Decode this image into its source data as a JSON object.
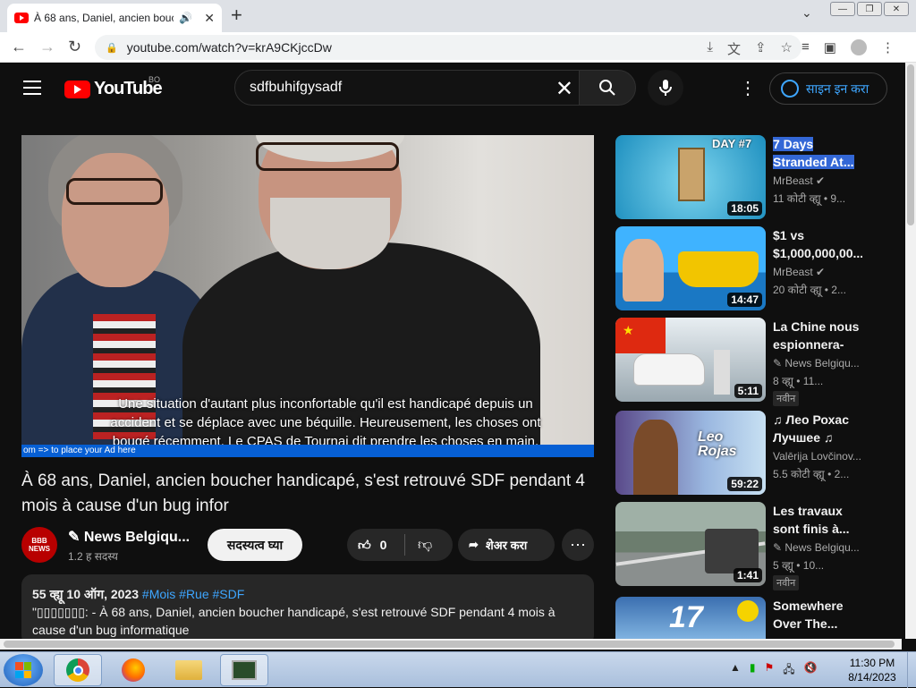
{
  "browser": {
    "tab_title": "À 68 ans, Daniel, ancien bouc",
    "audio_icon": "speaker-icon",
    "url": "youtube.com/watch?v=krA9CKjccDw"
  },
  "masthead": {
    "logo_text": "YouTube",
    "country_code": "BO",
    "search_value": "sdfbuhifgysadf",
    "signin_label": "साइन इन करा"
  },
  "player": {
    "captions": [
      "Une situation d'autant plus inconfortable qu'il est handicapé depuis un",
      "accident et se déplace avec une béquille. Heureusement, les choses ont",
      "bougé récemment. Le CPAS de Tournai dit prendre les choses en main,"
    ],
    "ad_text": "om => to place your Ad here"
  },
  "video": {
    "title": "À 68 ans, Daniel, ancien boucher handicapé, s'est retrouvé SDF pendant 4 mois à cause d'un bug infor",
    "channel_avatar_text": "BBB NEWS",
    "channel_name": "✎ News Belgiqu...",
    "subscribers": "1.2 ह सदस्य",
    "subscribe_label": "सदस्यत्व घ्या",
    "likes": "0",
    "share_label": "शेअर करा"
  },
  "description": {
    "meta": "55 व्ह्यू  10 ऑग, 2023",
    "tags": [
      "#Mois",
      "#Rue",
      "#SDF"
    ],
    "text": "\"▯▯▯▯▯▯▯: - À 68 ans, Daniel, ancien boucher handicapé, s'est retrouvé SDF pendant 4 mois à cause d'un bug informatique"
  },
  "recommendations": [
    {
      "title": "7 Days Stranded At...",
      "channel": "MrBeast ✔",
      "views": "11 कोटी व्ह्यू  • 9...",
      "duration": "18:05",
      "badge": ""
    },
    {
      "title": "$1 vs $1,000,000,00...",
      "channel": "MrBeast ✔",
      "views": "20 कोटी व्ह्यू  • 2...",
      "duration": "14:47",
      "badge": ""
    },
    {
      "title": "La Chine nous espionnera-t-...",
      "channel": "✎ News Belgiqu...",
      "views": "8 व्ह्यू  • 11...",
      "duration": "5:11",
      "badge": "नवीन"
    },
    {
      "title": "♫ Лео Рохас Лучшее ♫ Th...",
      "channel": "Valērija Lovčinov...",
      "views": "5.5 कोटी व्ह्यू  • 2...",
      "duration": "59:22",
      "badge": ""
    },
    {
      "title": "Les travaux sont finis à...",
      "channel": "✎ News Belgiqu...",
      "views": "5 व्ह्यू  • 10...",
      "duration": "1:41",
      "badge": "नवीन"
    },
    {
      "title": "Somewhere Over The...",
      "channel": "",
      "views": "",
      "duration": "",
      "badge": ""
    }
  ],
  "thumb_texts": {
    "day7": "DAY #7",
    "leo": "Leo Rojas",
    "n17": "17"
  },
  "taskbar": {
    "time": "11:30 PM",
    "date": "8/14/2023"
  },
  "colors": {
    "brand": "#ff0000",
    "link": "#3ea6ff",
    "bg": "#0f0f0f"
  }
}
